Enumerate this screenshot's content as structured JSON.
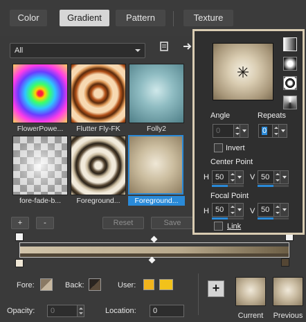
{
  "tabs": [
    {
      "label": "Color"
    },
    {
      "label": "Gradient",
      "active": true
    },
    {
      "label": "Pattern"
    },
    {
      "label": "Texture"
    }
  ],
  "category": {
    "value": "All"
  },
  "gradients": [
    {
      "label": "FlowerPowe..."
    },
    {
      "label": "Flutter Fly-FK"
    },
    {
      "label": "Folly2"
    },
    {
      "label": "fore-fade-b..."
    },
    {
      "label": "Foreground..."
    },
    {
      "label": "Foreground...",
      "selected": true
    }
  ],
  "buttons": {
    "add": "+",
    "remove": "-",
    "reset": "Reset",
    "save": "Save"
  },
  "footer": {
    "fore_label": "Fore:",
    "back_label": "Back:",
    "user_label": "User:",
    "opacity_label": "Opacity:",
    "opacity_value": "0",
    "location_label": "Location:",
    "location_value": "0",
    "plus": "+",
    "current_label": "Current",
    "previous_label": "Previous"
  },
  "colors": {
    "accent": "#2a8ad8",
    "user_swatch_1": "#f2b41c",
    "user_swatch_2": "#f2c21a",
    "popup_border": "#d9ccb2"
  },
  "popup": {
    "angle_label": "Angle",
    "angle_value": "0",
    "repeats_label": "Repeats",
    "repeats_value": "0",
    "invert_label": "Invert",
    "center_label": "Center Point",
    "center_h": "50",
    "center_v": "50",
    "focal_label": "Focal Point",
    "focal_h": "50",
    "focal_v": "50",
    "h_label": "H",
    "v_label": "V",
    "link_label": "Link",
    "slider_fraction": 0.5
  }
}
